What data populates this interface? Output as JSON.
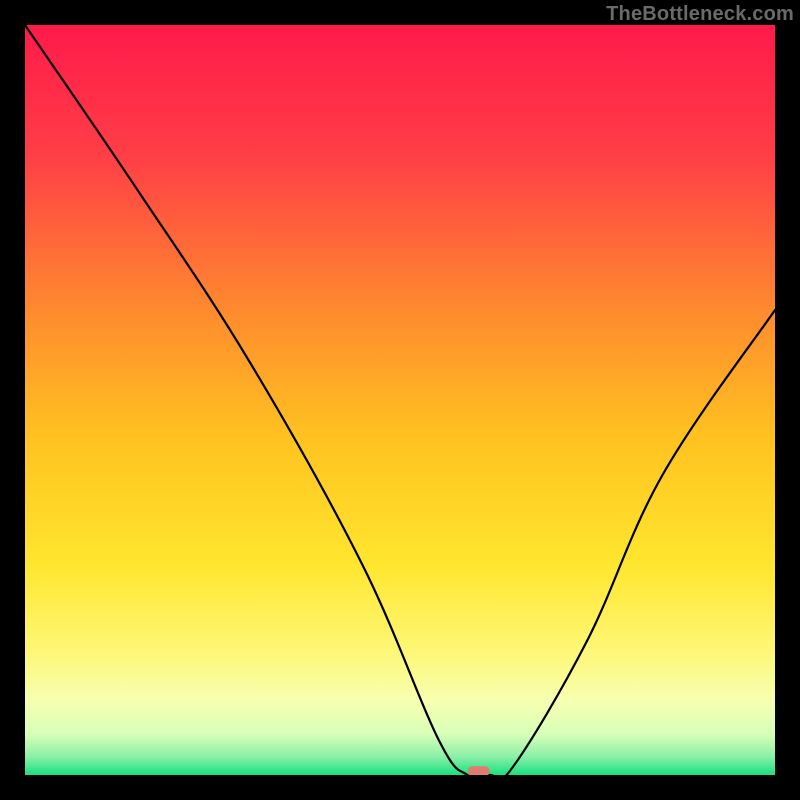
{
  "watermark": "TheBottleneck.com",
  "chart_data": {
    "type": "line",
    "title": "",
    "xlabel": "",
    "ylabel": "",
    "xlim": [
      0,
      100
    ],
    "ylim": [
      0,
      100
    ],
    "grid": false,
    "series": [
      {
        "name": "curve",
        "x": [
          0,
          15,
          30,
          45,
          55,
          59,
          62,
          65,
          75,
          85,
          100
        ],
        "values": [
          100,
          78,
          55,
          28,
          5,
          0,
          0,
          1,
          18,
          40,
          62
        ]
      }
    ],
    "marker": {
      "x": 60.5,
      "y": 0.5,
      "color": "#e17a6f"
    },
    "background_gradient": {
      "stops": [
        {
          "offset": 0.0,
          "color": "#ff1a4a"
        },
        {
          "offset": 0.18,
          "color": "#ff4046"
        },
        {
          "offset": 0.38,
          "color": "#ff8a2e"
        },
        {
          "offset": 0.55,
          "color": "#ffc220"
        },
        {
          "offset": 0.72,
          "color": "#ffe62e"
        },
        {
          "offset": 0.84,
          "color": "#fdf87a"
        },
        {
          "offset": 0.9,
          "color": "#f7ffb0"
        },
        {
          "offset": 0.945,
          "color": "#d8ffb8"
        },
        {
          "offset": 0.975,
          "color": "#8df0a8"
        },
        {
          "offset": 1.0,
          "color": "#18e07f"
        }
      ]
    }
  }
}
